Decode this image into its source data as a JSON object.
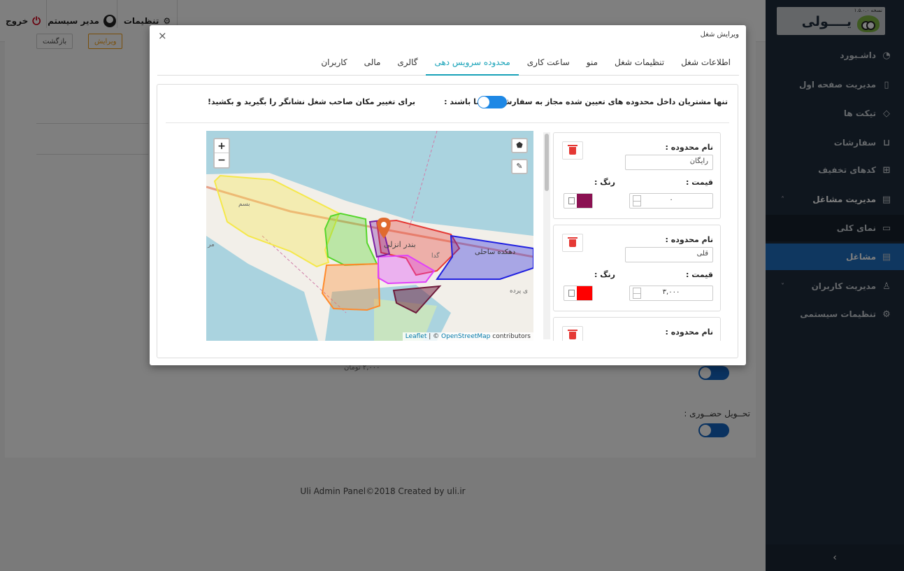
{
  "topbar": {
    "logout_label": "خروج",
    "admin_label": "مدیر سیستم",
    "settings_label": "تنظیمات"
  },
  "background": {
    "edit_btn": "ویرایش",
    "back_btn": "بازگشت",
    "price_text": "۲,۰۰۰ تومان",
    "delivery_label": "تحــویل حضــوری :",
    "footer": "Uli Admin Panel©2018 Created by uli.ir"
  },
  "sidebar": {
    "brand_name": "یــــولی",
    "brand_version": "نسخه ۱.۵.۰.۰",
    "items": [
      {
        "label": "داشـبورد",
        "icon": "dashboard-icon"
      },
      {
        "label": "مدیریت صفحه اول",
        "icon": "tablet-icon"
      },
      {
        "label": "تیکت ها",
        "icon": "tag-icon"
      },
      {
        "label": "سفارشات",
        "icon": "cart-icon"
      },
      {
        "label": "کدهای تخفیف",
        "icon": "gift-icon"
      },
      {
        "label": "مدیریت مشاغل",
        "icon": "store-icon"
      },
      {
        "label": "نمای کلی",
        "icon": "monitor-icon"
      },
      {
        "label": "مشاغل",
        "icon": "store-icon"
      },
      {
        "label": "مدیریت کاربران",
        "icon": "users-icon"
      },
      {
        "label": "تنظیمات سیستمی",
        "icon": "gear-icon"
      }
    ],
    "collapse_glyph": "›"
  },
  "modal": {
    "title": "ویرایش شغل",
    "close": "×",
    "tabs": [
      "اطلاعات شغل",
      "تنظیمات شغل",
      "منو",
      "ساعت کاری",
      "محدوده سرویس دهی",
      "گالری",
      "مالی",
      "کاربران"
    ],
    "active_tab": "محدوده سرویس دهی",
    "restrict_text": "تنها مشتریان داخل محدوده های تعیین شده مجاز به سفارش از شما باشند :",
    "restrict_enabled": true,
    "hint_text": "برای تغییر مکان صاحب شغل نشانگر را بگیرید و بکشید!",
    "zone_name_label": "نام محدوده :",
    "price_label": "قیمت :",
    "color_label": "رنگ :",
    "zones": [
      {
        "name": "رایگان",
        "price": "۰",
        "color": "#8b1152"
      },
      {
        "name": "قلی",
        "price": "۳,۰۰۰",
        "color": "#ff0000"
      },
      {
        "name": "",
        "price": "",
        "color": ""
      }
    ]
  },
  "map": {
    "zoom_in": "+",
    "zoom_out": "−",
    "city_label": "بندر انزلی",
    "district_label": "دهکده ساحلی",
    "label_beshm": "بسم",
    "label_gedda": "گدا",
    "label_pardeh": "ی پرده",
    "label_mr": "مر",
    "attribution_leaflet": "Leaflet",
    "attribution_sep": " | © ",
    "attribution_osm": "OpenStreetMap",
    "attribution_tail": " contributors",
    "polygon_colors": [
      "#f5e84a",
      "#55d62b",
      "#e53935",
      "#2020e0",
      "#ff8a2b",
      "#e040fb",
      "#7b1fa2",
      "#6d1a3a"
    ]
  }
}
